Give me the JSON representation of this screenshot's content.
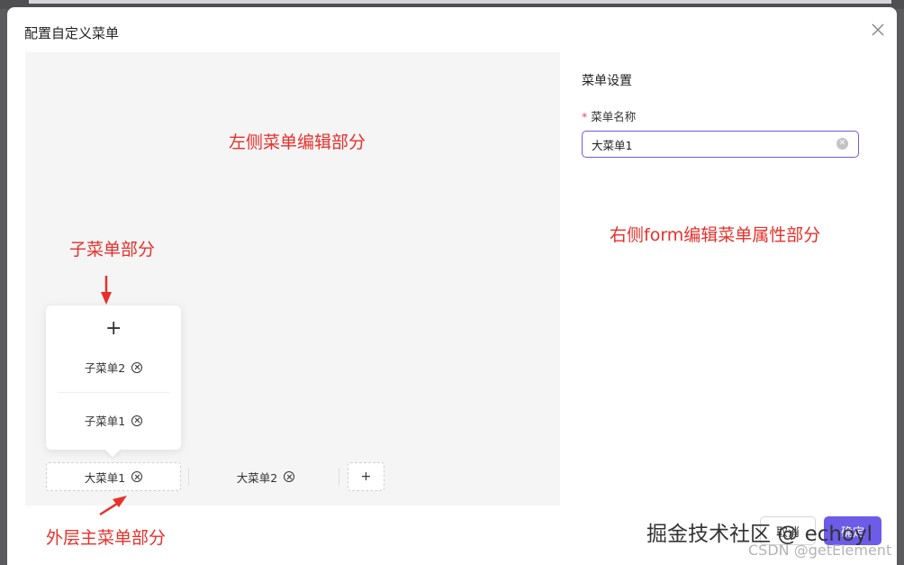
{
  "dialog": {
    "title": "配置自定义菜单",
    "close_icon": "close-icon"
  },
  "right": {
    "section_title": "菜单设置",
    "required_mark": "*",
    "field_label": "菜单名称",
    "field_value": "大菜单1",
    "clear_icon": "clear-circle-icon"
  },
  "annotations": {
    "left_area": "左侧菜单编辑部分",
    "sub_menu": "子菜单部分",
    "main_menu": "外层主菜单部分",
    "right_area": "右侧form编辑菜单属性部分"
  },
  "submenu": {
    "add_symbol": "+",
    "items": [
      {
        "label": "子菜单2"
      },
      {
        "label": "子菜单1"
      }
    ]
  },
  "main_menus": [
    {
      "label": "大菜单1",
      "active": true
    },
    {
      "label": "大菜单2",
      "active": false
    }
  ],
  "main_add_symbol": "+",
  "footer": {
    "cancel_label": "取消",
    "ok_label": "确定"
  },
  "watermark": {
    "main": "掘金技术社区 @ echoyl",
    "sub": "CSDN @getElement"
  },
  "colors": {
    "primary": "#6c5ce7",
    "annotation_red": "#e8302a",
    "panel_bg": "#f5f5f6"
  }
}
